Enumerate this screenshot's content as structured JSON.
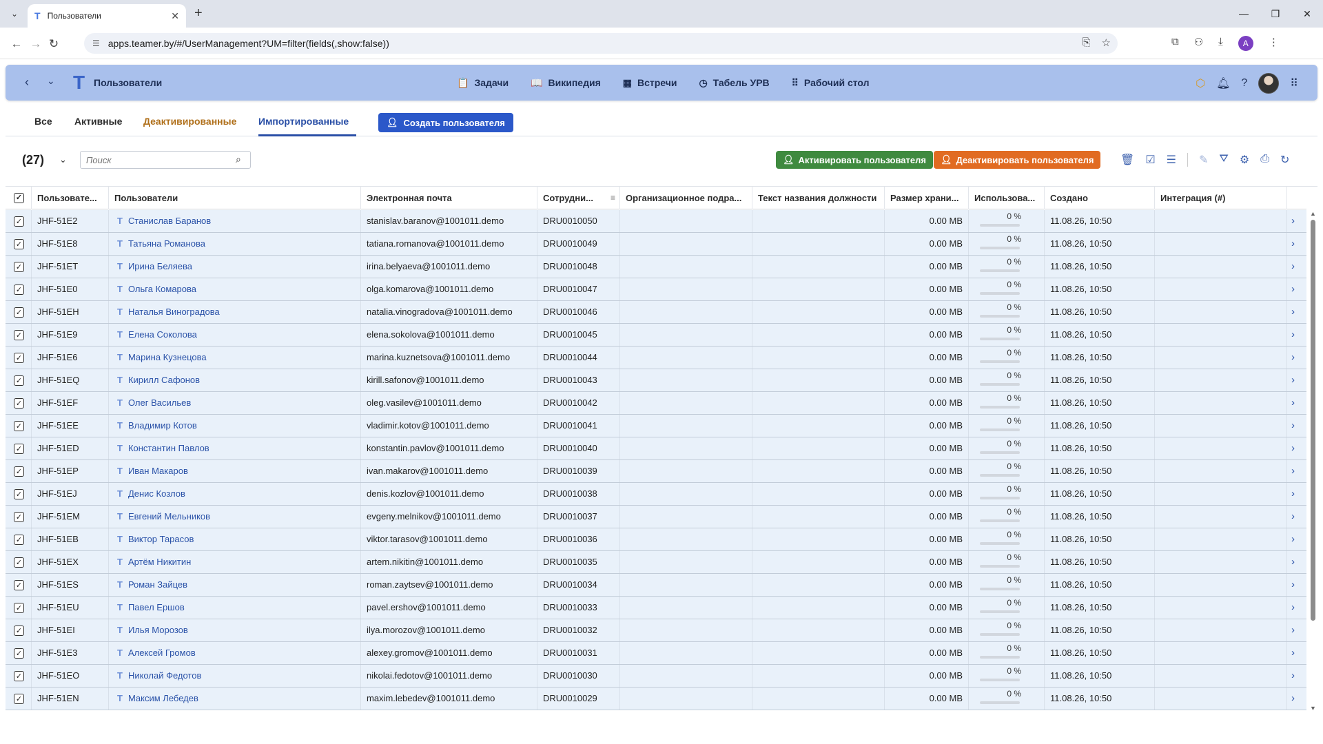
{
  "browser": {
    "tab_title": "Пользователи",
    "url": "apps.teamer.by/#/UserManagement?UM=filter(fields(,show:false))",
    "profile_initial": "A"
  },
  "header": {
    "title": "Пользователи",
    "nav": [
      {
        "label": "Задачи",
        "icon": "clipboard-icon"
      },
      {
        "label": "Википедия",
        "icon": "book-icon"
      },
      {
        "label": "Встречи",
        "icon": "calendar-icon"
      },
      {
        "label": "Табель УРВ",
        "icon": "timesheet-icon"
      },
      {
        "label": "Рабочий стол",
        "icon": "grid-icon"
      }
    ]
  },
  "tabs": {
    "all": "Все",
    "active": "Активные",
    "deactivated": "Деактивированные",
    "imported": "Импортированные",
    "selected": "Импортированные",
    "create_button": "Создать пользователя"
  },
  "filter": {
    "count": "(27)",
    "search_placeholder": "Поиск",
    "activate_button": "Активировать пользователя",
    "deactivate_button": "Деактивировать пользователя"
  },
  "table": {
    "columns": {
      "user_id": "Пользовате...",
      "users": "Пользователи",
      "email": "Электронная почта",
      "employee": "Сотрудни...",
      "org_unit": "Организационное подра...",
      "job_title": "Текст названия должности",
      "storage": "Размер храни...",
      "usage": "Использова...",
      "created": "Создано",
      "integration": "Интеграция (#)"
    },
    "rows": [
      {
        "id": "JHF-51E2",
        "name": "Станислав Баранов",
        "email": "stanislav.baranov@1001011.demo",
        "emp": "DRU0010050",
        "size": "0.00 MB",
        "usage": "0 %",
        "created": "11.08.26, 10:50"
      },
      {
        "id": "JHF-51E8",
        "name": "Татьяна Романова",
        "email": "tatiana.romanova@1001011.demo",
        "emp": "DRU0010049",
        "size": "0.00 MB",
        "usage": "0 %",
        "created": "11.08.26, 10:50"
      },
      {
        "id": "JHF-51ET",
        "name": "Ирина Беляева",
        "email": "irina.belyaeva@1001011.demo",
        "emp": "DRU0010048",
        "size": "0.00 MB",
        "usage": "0 %",
        "created": "11.08.26, 10:50"
      },
      {
        "id": "JHF-51E0",
        "name": "Ольга Комарова",
        "email": "olga.komarova@1001011.demo",
        "emp": "DRU0010047",
        "size": "0.00 MB",
        "usage": "0 %",
        "created": "11.08.26, 10:50"
      },
      {
        "id": "JHF-51EH",
        "name": "Наталья Виноградова",
        "email": "natalia.vinogradova@1001011.demo",
        "emp": "DRU0010046",
        "size": "0.00 MB",
        "usage": "0 %",
        "created": "11.08.26, 10:50"
      },
      {
        "id": "JHF-51E9",
        "name": "Елена Соколова",
        "email": "elena.sokolova@1001011.demo",
        "emp": "DRU0010045",
        "size": "0.00 MB",
        "usage": "0 %",
        "created": "11.08.26, 10:50"
      },
      {
        "id": "JHF-51E6",
        "name": "Марина Кузнецова",
        "email": "marina.kuznetsova@1001011.demo",
        "emp": "DRU0010044",
        "size": "0.00 MB",
        "usage": "0 %",
        "created": "11.08.26, 10:50"
      },
      {
        "id": "JHF-51EQ",
        "name": "Кирилл Сафонов",
        "email": "kirill.safonov@1001011.demo",
        "emp": "DRU0010043",
        "size": "0.00 MB",
        "usage": "0 %",
        "created": "11.08.26, 10:50"
      },
      {
        "id": "JHF-51EF",
        "name": "Олег Васильев",
        "email": "oleg.vasilev@1001011.demo",
        "emp": "DRU0010042",
        "size": "0.00 MB",
        "usage": "0 %",
        "created": "11.08.26, 10:50"
      },
      {
        "id": "JHF-51EE",
        "name": "Владимир Котов",
        "email": "vladimir.kotov@1001011.demo",
        "emp": "DRU0010041",
        "size": "0.00 MB",
        "usage": "0 %",
        "created": "11.08.26, 10:50"
      },
      {
        "id": "JHF-51ED",
        "name": "Константин Павлов",
        "email": "konstantin.pavlov@1001011.demo",
        "emp": "DRU0010040",
        "size": "0.00 MB",
        "usage": "0 %",
        "created": "11.08.26, 10:50"
      },
      {
        "id": "JHF-51EP",
        "name": "Иван Макаров",
        "email": "ivan.makarov@1001011.demo",
        "emp": "DRU0010039",
        "size": "0.00 MB",
        "usage": "0 %",
        "created": "11.08.26, 10:50"
      },
      {
        "id": "JHF-51EJ",
        "name": "Денис Козлов",
        "email": "denis.kozlov@1001011.demo",
        "emp": "DRU0010038",
        "size": "0.00 MB",
        "usage": "0 %",
        "created": "11.08.26, 10:50"
      },
      {
        "id": "JHF-51EM",
        "name": "Евгений Мельников",
        "email": "evgeny.melnikov@1001011.demo",
        "emp": "DRU0010037",
        "size": "0.00 MB",
        "usage": "0 %",
        "created": "11.08.26, 10:50"
      },
      {
        "id": "JHF-51EB",
        "name": "Виктор Тарасов",
        "email": "viktor.tarasov@1001011.demo",
        "emp": "DRU0010036",
        "size": "0.00 MB",
        "usage": "0 %",
        "created": "11.08.26, 10:50"
      },
      {
        "id": "JHF-51EX",
        "name": "Артём Никитин",
        "email": "artem.nikitin@1001011.demo",
        "emp": "DRU0010035",
        "size": "0.00 MB",
        "usage": "0 %",
        "created": "11.08.26, 10:50"
      },
      {
        "id": "JHF-51ES",
        "name": "Роман Зайцев",
        "email": "roman.zaytsev@1001011.demo",
        "emp": "DRU0010034",
        "size": "0.00 MB",
        "usage": "0 %",
        "created": "11.08.26, 10:50"
      },
      {
        "id": "JHF-51EU",
        "name": "Павел Ершов",
        "email": "pavel.ershov@1001011.demo",
        "emp": "DRU0010033",
        "size": "0.00 MB",
        "usage": "0 %",
        "created": "11.08.26, 10:50"
      },
      {
        "id": "JHF-51EI",
        "name": "Илья Морозов",
        "email": "ilya.morozov@1001011.demo",
        "emp": "DRU0010032",
        "size": "0.00 MB",
        "usage": "0 %",
        "created": "11.08.26, 10:50"
      },
      {
        "id": "JHF-51E3",
        "name": "Алексей Громов",
        "email": "alexey.gromov@1001011.demo",
        "emp": "DRU0010031",
        "size": "0.00 MB",
        "usage": "0 %",
        "created": "11.08.26, 10:50"
      },
      {
        "id": "JHF-51EO",
        "name": "Николай Федотов",
        "email": "nikolai.fedotov@1001011.demo",
        "emp": "DRU0010030",
        "size": "0.00 MB",
        "usage": "0 %",
        "created": "11.08.26, 10:50"
      },
      {
        "id": "JHF-51EN",
        "name": "Максим Лебедев",
        "email": "maxim.lebedev@1001011.demo",
        "emp": "DRU0010029",
        "size": "0.00 MB",
        "usage": "0 %",
        "created": "11.08.26, 10:50"
      }
    ]
  },
  "colors": {
    "header_bg": "#a9c0ec",
    "accent": "#2b58c9",
    "activate": "#3f8a3f",
    "deactivate": "#e16b22",
    "row_bg": "#e9f1fa"
  }
}
